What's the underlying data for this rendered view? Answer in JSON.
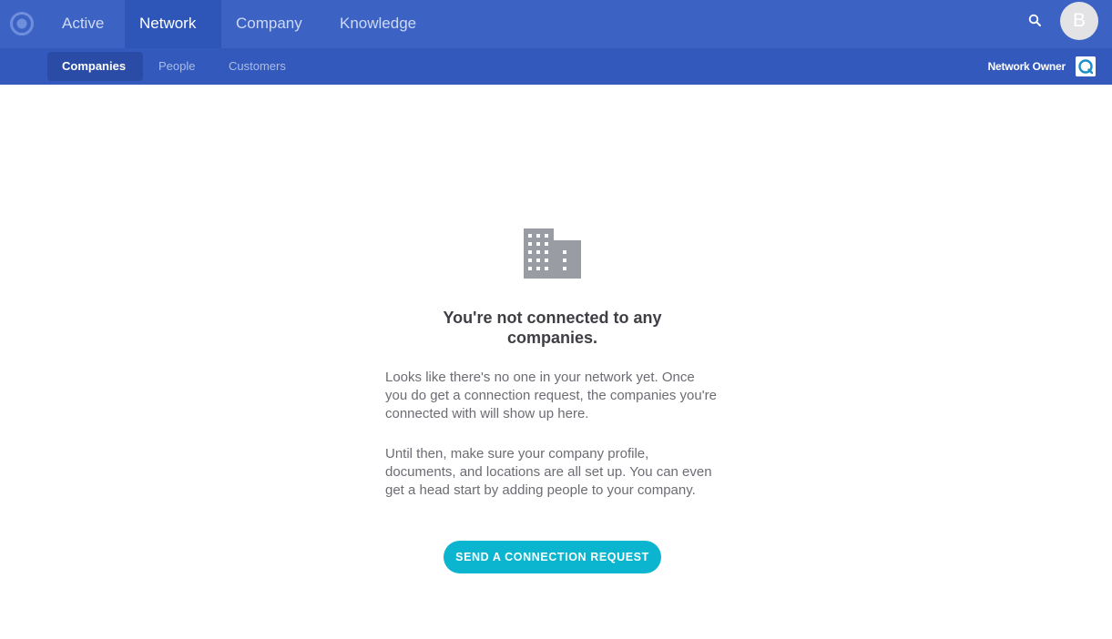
{
  "topnav": {
    "tabs": [
      {
        "label": "Active",
        "active": false
      },
      {
        "label": "Network",
        "active": true
      },
      {
        "label": "Company",
        "active": false
      },
      {
        "label": "Knowledge",
        "active": false
      }
    ],
    "avatar_initial": "B"
  },
  "subnav": {
    "tabs": [
      {
        "label": "Companies",
        "active": true
      },
      {
        "label": "People",
        "active": false
      },
      {
        "label": "Customers",
        "active": false
      }
    ],
    "role_label": "Network Owner"
  },
  "empty_state": {
    "title": "You're not connected to any companies.",
    "paragraph1": "Looks like there's no one in your network yet. Once you do get a connection request, the companies you're connected with will show up here.",
    "paragraph2": "Until then, make sure your company profile, documents, and locations are all set up. You can even get a head start by adding people to your company.",
    "cta_label": "SEND A CONNECTION REQUEST"
  },
  "icons": {
    "logo": "app-logo-icon",
    "search": "search-icon",
    "role": "network-role-icon",
    "empty": "building-icon"
  },
  "colors": {
    "topbar": "#3c63c4",
    "topbar_active": "#2e55b8",
    "subbar": "#3359bd",
    "subbar_active": "#2a4ca6",
    "cta": "#0bb5d0",
    "icon_gray": "#9a9ca3"
  }
}
